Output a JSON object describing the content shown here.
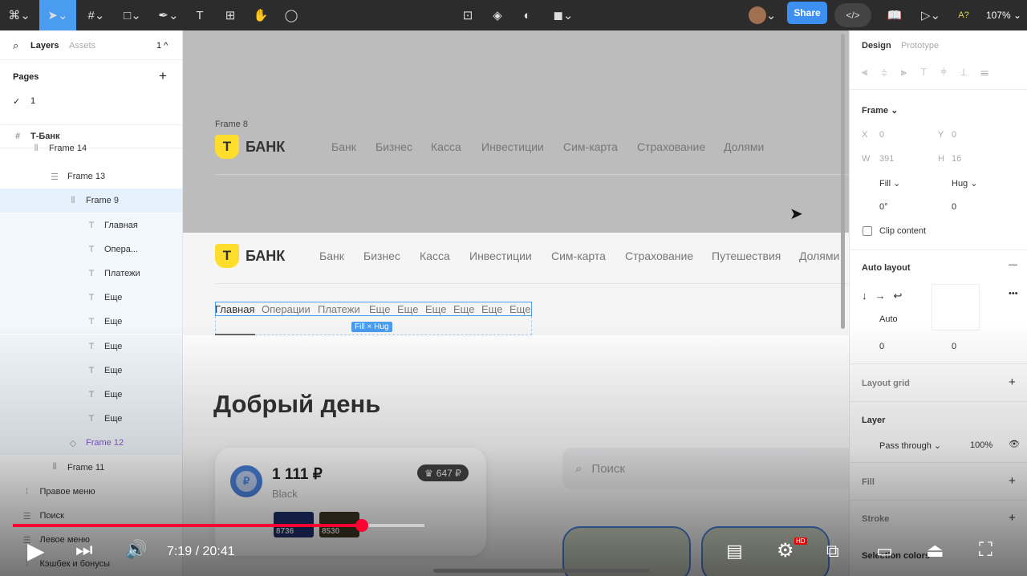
{
  "toolbar": {
    "share": "Share",
    "zoom": "107% ⌄",
    "a11y": "A?"
  },
  "left": {
    "tabs": [
      "Layers",
      "Assets"
    ],
    "page_count": "1 ^",
    "pages_title": "Pages",
    "pages": [
      "1"
    ],
    "layers": [
      {
        "name": "Т-Банк",
        "indent": 0,
        "icon": "#"
      },
      {
        "name": "Frame 14",
        "indent": 1,
        "icon": "⫴"
      },
      {
        "name": "Frame 13",
        "indent": 2,
        "icon": "☰"
      },
      {
        "name": "Frame 9",
        "indent": 3,
        "icon": "⫴",
        "selected": true
      },
      {
        "name": "Главная",
        "indent": 4,
        "icon": "T"
      },
      {
        "name": "Опера...",
        "indent": 4,
        "icon": "T"
      },
      {
        "name": "Платежи",
        "indent": 4,
        "icon": "T"
      },
      {
        "name": "Еще",
        "indent": 4,
        "icon": "T"
      },
      {
        "name": "Еще",
        "indent": 4,
        "icon": "T"
      },
      {
        "name": "Еще",
        "indent": 4,
        "icon": "T"
      },
      {
        "name": "Еще",
        "indent": 4,
        "icon": "T"
      },
      {
        "name": "Еще",
        "indent": 4,
        "icon": "T"
      },
      {
        "name": "Еще",
        "indent": 4,
        "icon": "T"
      },
      {
        "name": "Frame 12",
        "indent": 3,
        "icon": "◇",
        "component": true
      },
      {
        "name": "Frame 11",
        "indent": 2,
        "icon": "⫴"
      },
      {
        "name": "Правое меню",
        "indent": 0.5,
        "icon": "⁞"
      },
      {
        "name": "Поиск",
        "indent": 0.5,
        "icon": "☰"
      },
      {
        "name": "Левое меню",
        "indent": 0.5,
        "icon": "☰"
      },
      {
        "name": "Кэшбек и бонусы",
        "indent": 0.5,
        "icon": "⁞"
      }
    ]
  },
  "canvas": {
    "frame8_label": "Frame 8",
    "logo": "БАНК",
    "logo_mark": "Т",
    "nav1": [
      "Банк",
      "Бизнес",
      "Касса",
      "Инвестиции",
      "Сим-карта",
      "Страхование",
      "Долями"
    ],
    "nav2": [
      "Банк",
      "Бизнес",
      "Касса",
      "Инвестиции",
      "Сим-карта",
      "Страхование",
      "Путешествия",
      "Долями"
    ],
    "tabs": [
      "Главная",
      "Операции",
      "Платежи",
      "Еще",
      "Еще",
      "Еще",
      "Еще",
      "Еще",
      "Еще"
    ],
    "size_badge": "Fill × Hug",
    "greeting": "Добрый день",
    "account": {
      "balance": "1 111 ₽",
      "name": "Black",
      "cashback": "647 ₽",
      "cards": [
        "8736",
        "8530"
      ]
    },
    "search_placeholder": "Поиск"
  },
  "right": {
    "tabs": [
      "Design",
      "Prototype"
    ],
    "frame": "Frame ⌄",
    "x": "0",
    "y": "0",
    "w": "391",
    "h": "16",
    "wmode": "Fill ⌄",
    "hmode": "Hug ⌄",
    "rotation": "0°",
    "radius": "0",
    "clip": "Clip content",
    "auto_layout": "Auto layout",
    "gap": "Auto",
    "pad_h": "0",
    "pad_v": "0",
    "layout_grid": "Layout grid",
    "layer": "Layer",
    "blend": "Pass through ⌄",
    "opacity": "100%",
    "fill": "Fill",
    "stroke": "Stroke",
    "selection_colors": "Selection colors"
  },
  "video": {
    "time": "7:19 / 20:41",
    "progress": 0.357,
    "buffered": 0.41,
    "accent": "#ff0033"
  }
}
